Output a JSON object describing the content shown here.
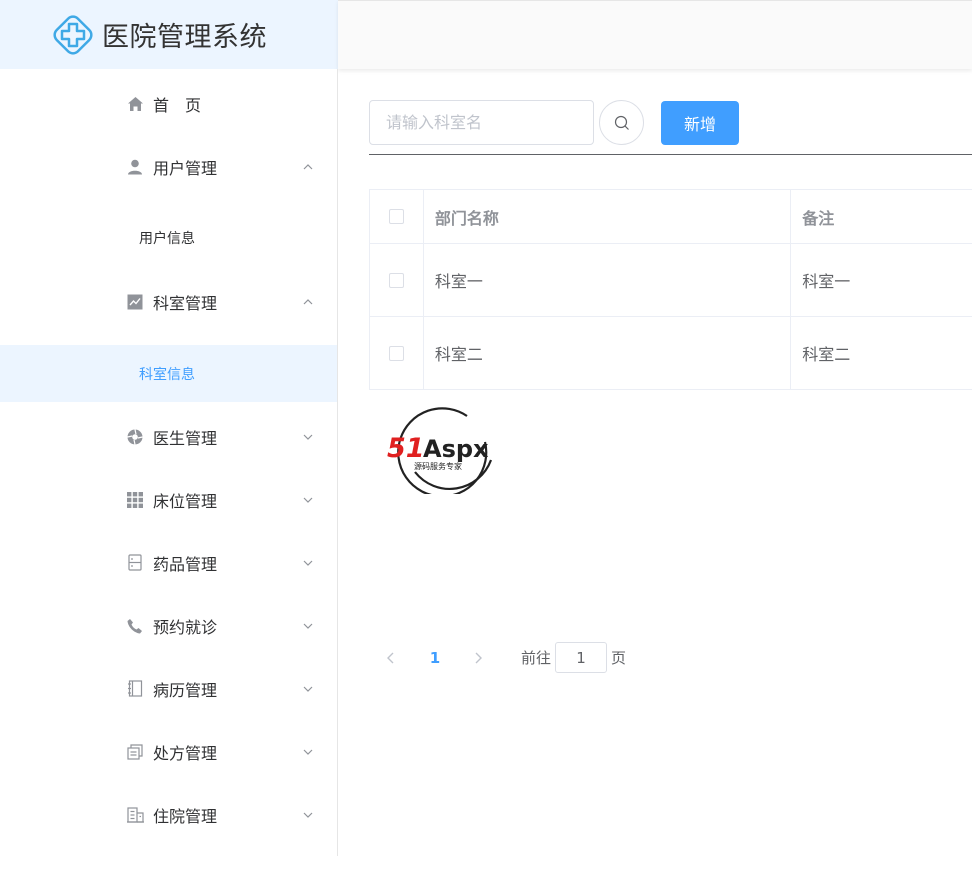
{
  "app": {
    "title": "医院管理系统"
  },
  "sidebar": {
    "items": [
      {
        "label": "首　页",
        "icon": "home-icon",
        "arrow": ""
      },
      {
        "label": "用户管理",
        "icon": "user-icon",
        "arrow": "up"
      },
      {
        "label": "科室管理",
        "icon": "chart-icon",
        "arrow": "up"
      },
      {
        "label": "医生管理",
        "icon": "aperture-icon",
        "arrow": "down"
      },
      {
        "label": "床位管理",
        "icon": "grid-icon",
        "arrow": "down"
      },
      {
        "label": "药品管理",
        "icon": "cabinet-icon",
        "arrow": "down"
      },
      {
        "label": "预约就诊",
        "icon": "phone-icon",
        "arrow": "down"
      },
      {
        "label": "病历管理",
        "icon": "notebook-icon",
        "arrow": "down"
      },
      {
        "label": "处方管理",
        "icon": "document-icon",
        "arrow": "down"
      },
      {
        "label": "住院管理",
        "icon": "building-icon",
        "arrow": "down"
      }
    ],
    "subitems": [
      {
        "label": "用户信息",
        "active": false
      },
      {
        "label": "科室信息",
        "active": true
      }
    ]
  },
  "toolbar": {
    "search_placeholder": "请输入科室名",
    "add_label": "新增"
  },
  "table": {
    "columns": [
      "部门名称",
      "备注"
    ],
    "rows": [
      [
        "科室一",
        "科室一"
      ],
      [
        "科室二",
        "科室二"
      ]
    ]
  },
  "watermark": {
    "brand": "51Aspx",
    "tagline": "源码服务专家"
  },
  "pagination": {
    "current": "1",
    "goto_label": "前往",
    "goto_value": "1",
    "page_unit": "页"
  },
  "colors": {
    "primary": "#409eff",
    "active_bg": "#ecf5ff"
  }
}
